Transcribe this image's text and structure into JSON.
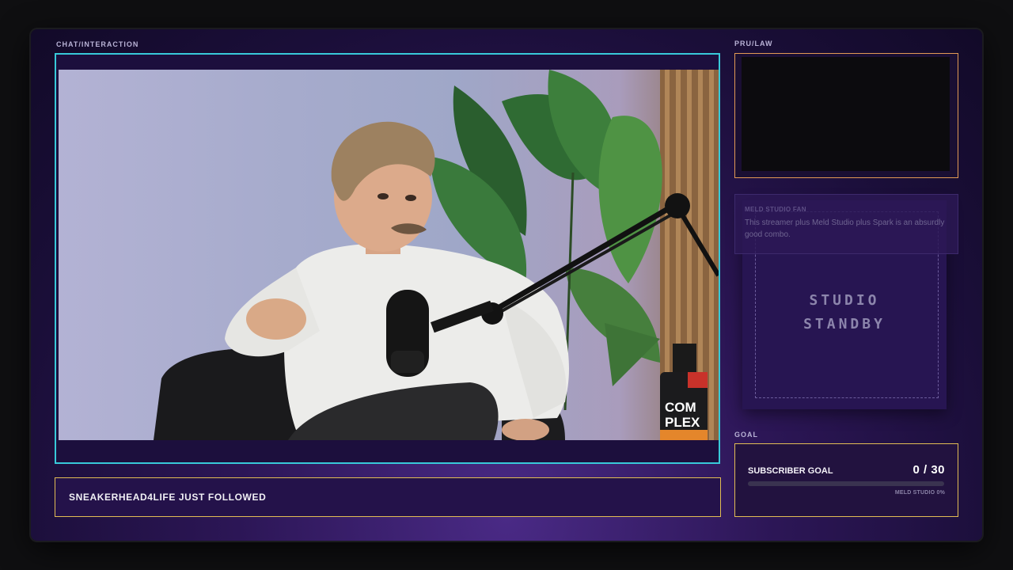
{
  "labels": {
    "chat": "CHAT/INTERACTION",
    "camera": "PRU/LAW",
    "goal": "GOAL"
  },
  "scene": {
    "brand": [
      "COM",
      "PLEX"
    ],
    "watermark_icon": "complex-logo-icon"
  },
  "alert": {
    "text": "SNEAKERHEAD4LIFE JUST FOLLOWED"
  },
  "standby": {
    "text": "STUDIO\nSTANDBY"
  },
  "chat_card": {
    "user": "MELD STUDIO FAN",
    "message": "This streamer plus Meld Studio plus Spark is an absurdly good combo."
  },
  "goal": {
    "title": "SUBSCRIBER GOAL",
    "count": "0 / 30",
    "progress": 0,
    "footer": "MELD STUDIO 0%"
  },
  "colors": {
    "video_border": "#38c9d9",
    "alert_border": "#e2bd54",
    "camera_border": "#e29a54",
    "goal_border": "#e2bd54"
  }
}
